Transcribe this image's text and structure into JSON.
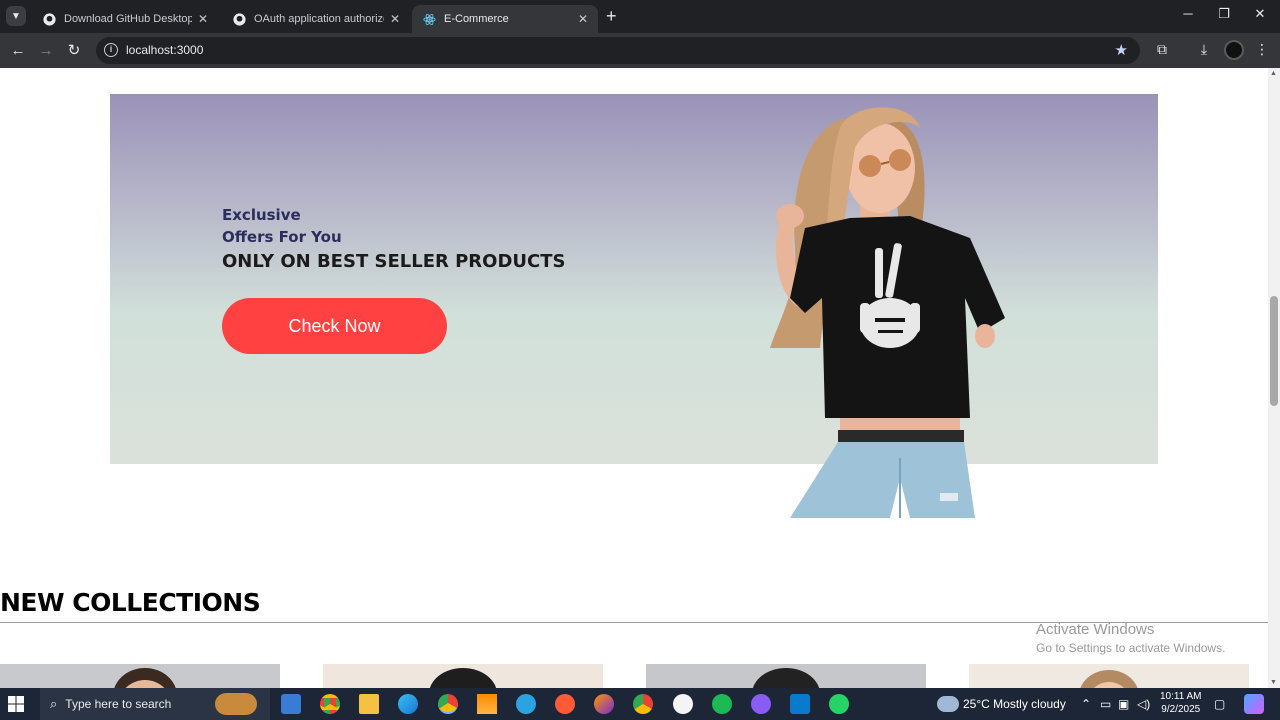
{
  "browser": {
    "tabs": [
      {
        "title": "Download GitHub Desktop | GitHub Desktop",
        "icon": "github-icon"
      },
      {
        "title": "OAuth application authorized",
        "icon": "github-icon"
      },
      {
        "title": "E-Commerce",
        "icon": "react-icon",
        "active": true
      }
    ],
    "url": "localhost:3000"
  },
  "hero": {
    "kicker_line1": "Exclusive",
    "kicker_line2": "Offers For You",
    "headline": "ONLY ON BEST SELLER PRODUCTS",
    "cta_label": "Check Now"
  },
  "collections": {
    "title": "NEW COLLECTIONS"
  },
  "watermark": {
    "line1": "Activate Windows",
    "line2": "Go to Settings to activate Windows."
  },
  "taskbar": {
    "search_placeholder": "Type here to search",
    "weather": "25°C  Mostly cloudy",
    "time": "10:11 AM",
    "date": "9/2/2025"
  },
  "colors": {
    "accent": "#ff4141",
    "hero_top": "#9a92b8",
    "hero_bottom": "#dbe1da",
    "heading_dark": "#2c2d5c"
  }
}
